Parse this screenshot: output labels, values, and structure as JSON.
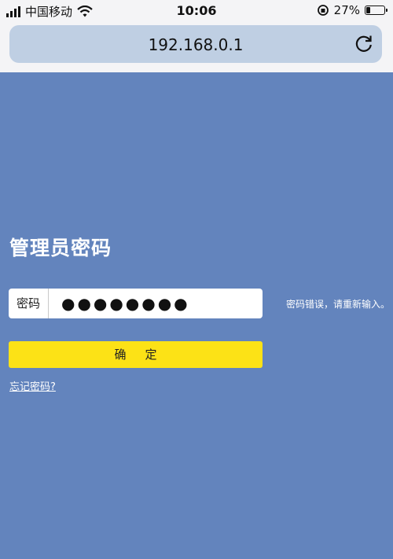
{
  "status_bar": {
    "carrier": "中国移动",
    "time": "10:06",
    "battery_percent": "27%",
    "battery_level": 0.27
  },
  "browser": {
    "url": "192.168.0.1"
  },
  "login": {
    "title": "管理员密码",
    "password_label": "密码",
    "password_value": "●●●●●●●●",
    "error_message": "密码错误，请重新输入。",
    "confirm_button": "确定",
    "forgot_link": "忘记密码?"
  },
  "colors": {
    "background": "#6384bd",
    "button": "#fce216",
    "url_bar": "#bfcfe3"
  }
}
